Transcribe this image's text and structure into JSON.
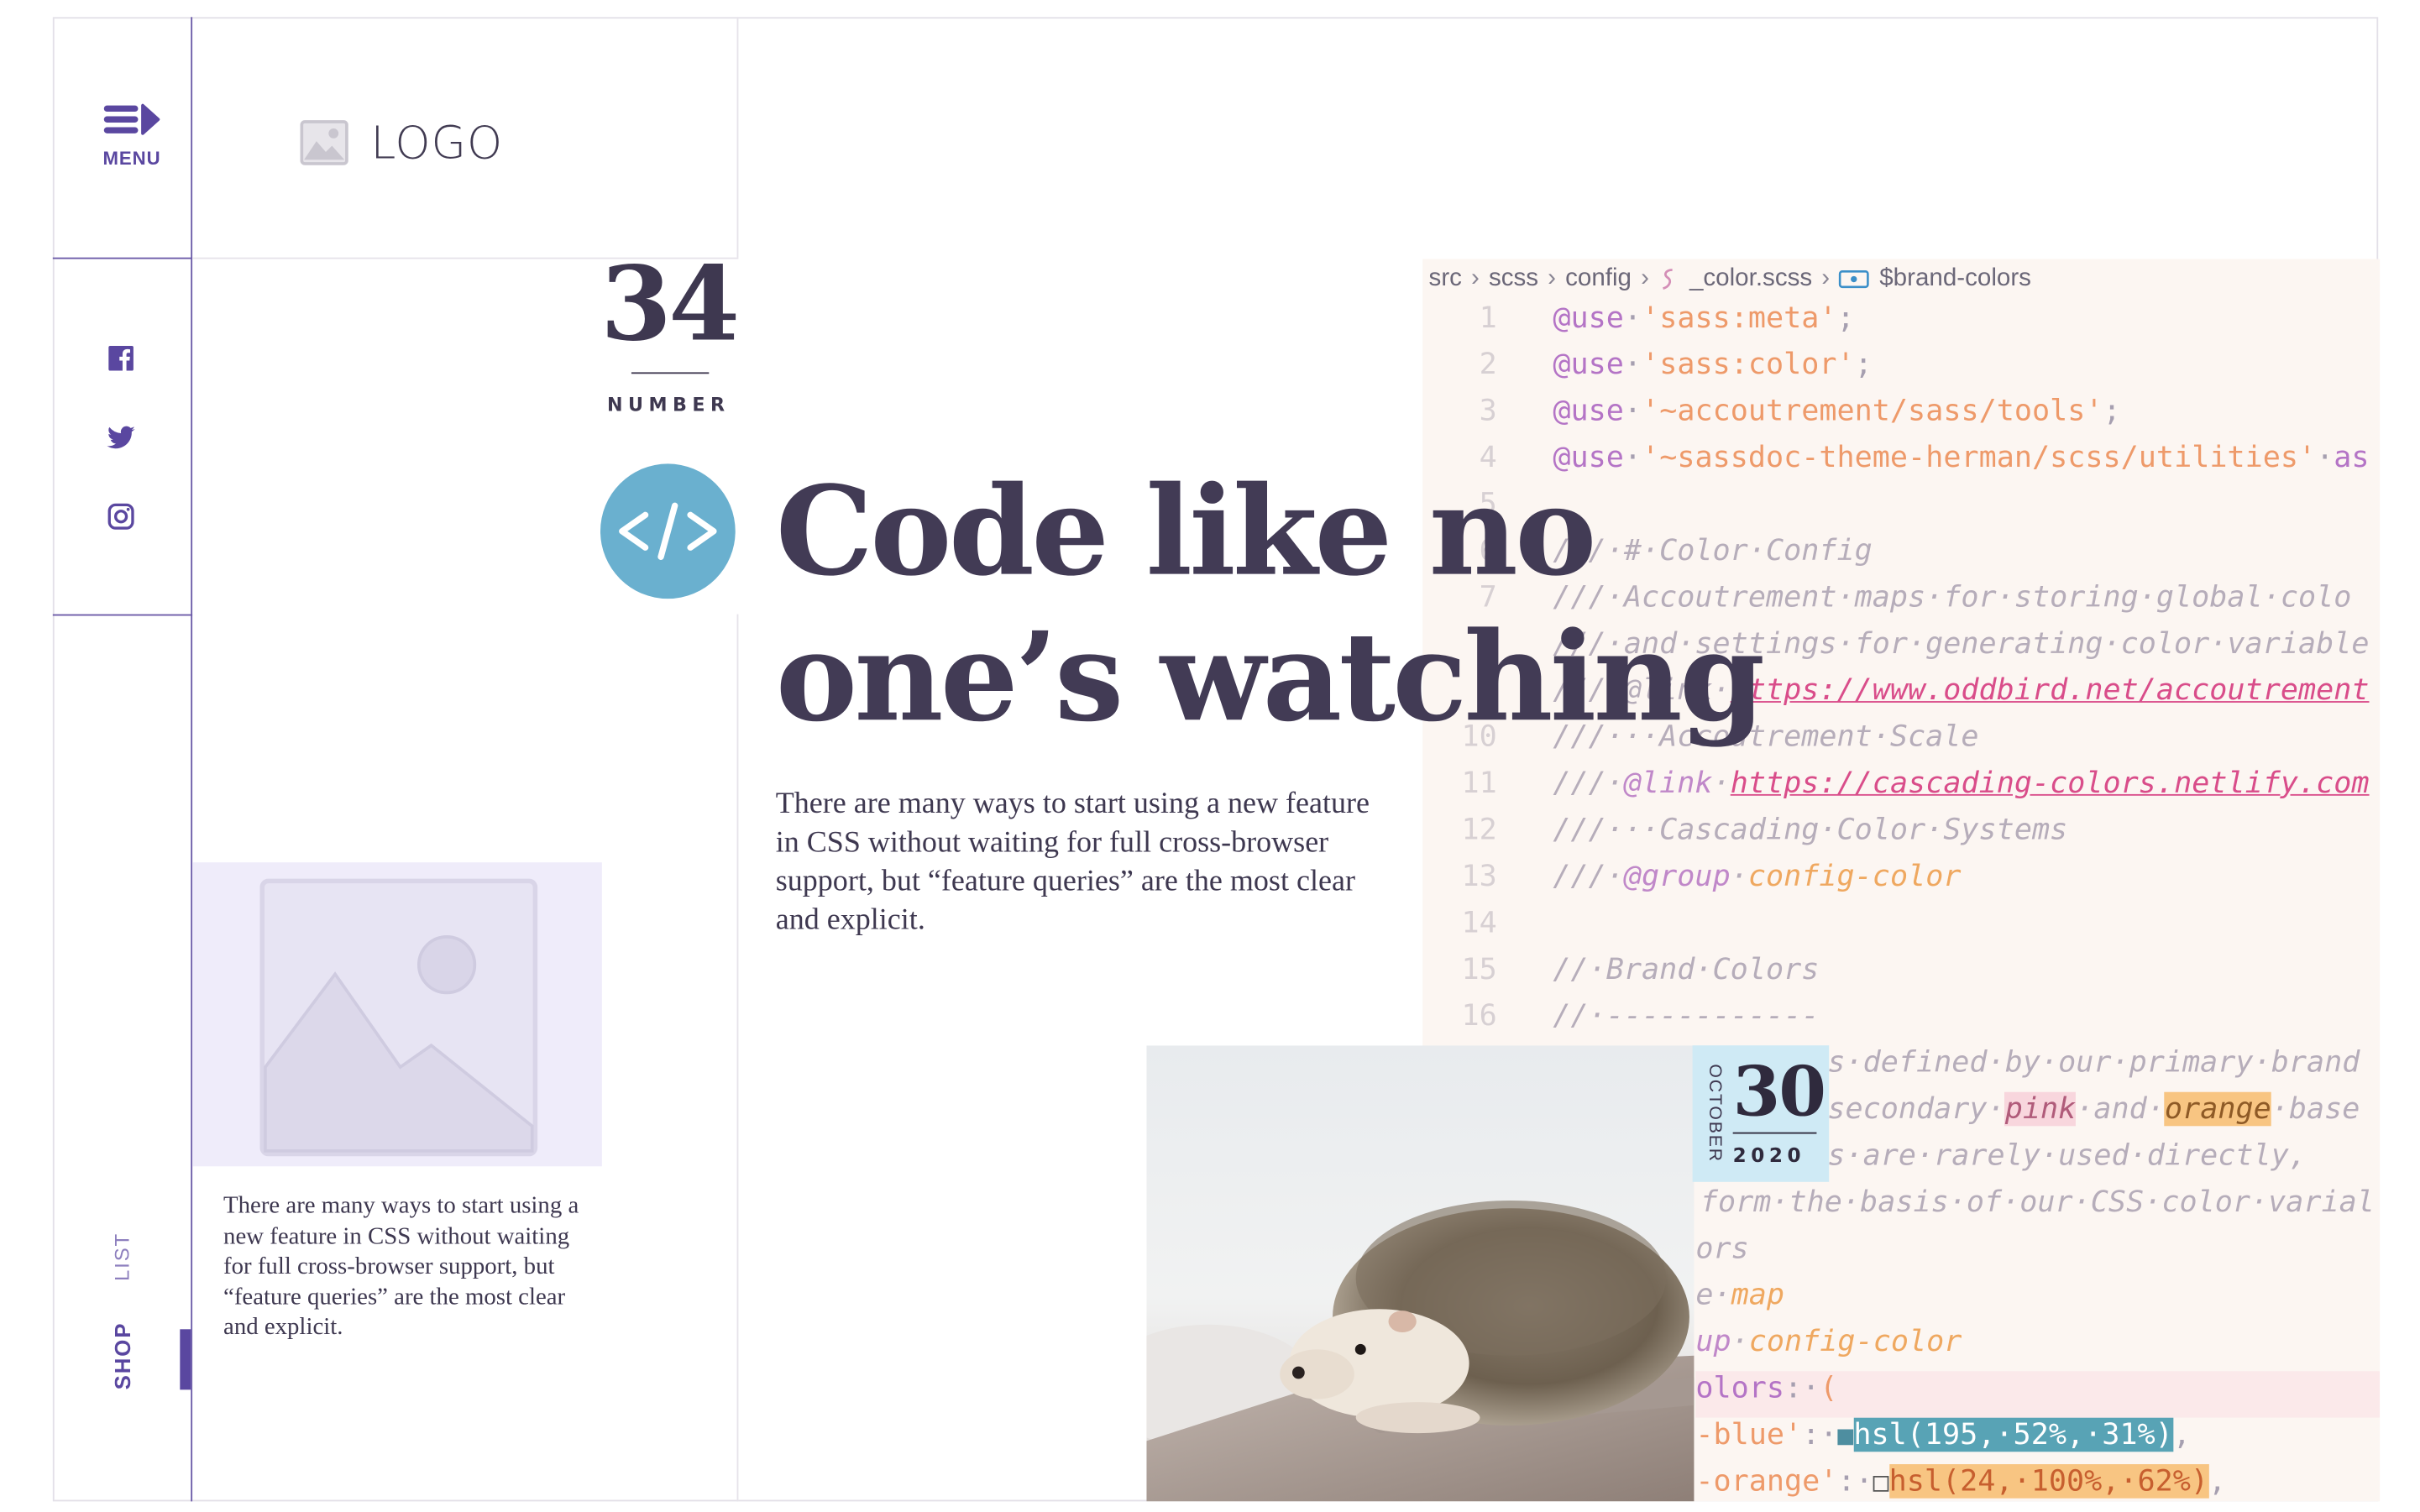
{
  "nav": {
    "menu_label": "MENU",
    "social": [
      "facebook-icon",
      "twitter-icon",
      "instagram-icon"
    ],
    "tabs": {
      "list": "LIST",
      "shop": "SHOP"
    }
  },
  "logo": {
    "text": "LOGO"
  },
  "issue": {
    "number": "34",
    "label": "NUMBER"
  },
  "article": {
    "headline_line1": "Code like no",
    "headline_line2": "one’s watching",
    "intro": "There are many ways to start using a new feature in CSS without waiting for full cross-browser support, but “feature queries” are the most clear and explicit."
  },
  "card": {
    "text": "There are many ways to start using a new feature in CSS without waiting for full cross-browser support, but “feature queries” are the most clear and explicit."
  },
  "editor": {
    "breadcrumbs": [
      "src",
      "scss",
      "config",
      "_color.scss",
      "$brand-colors"
    ],
    "lines": [
      {
        "n": "1",
        "parts": [
          [
            "kw",
            "@use"
          ],
          [
            "",
            "·"
          ],
          [
            "str",
            "'sass:meta'"
          ],
          [
            "",
            ";"
          ]
        ]
      },
      {
        "n": "2",
        "parts": [
          [
            "kw",
            "@use"
          ],
          [
            "",
            "·"
          ],
          [
            "str",
            "'sass:color'"
          ],
          [
            "",
            ";"
          ]
        ]
      },
      {
        "n": "3",
        "parts": [
          [
            "kw",
            "@use"
          ],
          [
            "",
            "·"
          ],
          [
            "str",
            "'~accoutrement/sass/tools'"
          ],
          [
            "",
            ";"
          ]
        ]
      },
      {
        "n": "4",
        "parts": [
          [
            "kw",
            "@use"
          ],
          [
            "",
            "·"
          ],
          [
            "str",
            "'~sassdoc-theme-herman/scss/utilities'"
          ],
          [
            "",
            "·"
          ],
          [
            "kw",
            "as"
          ]
        ]
      },
      {
        "n": "5",
        "parts": []
      },
      {
        "n": "6",
        "parts": [
          [
            "cm",
            "///·#·Color·Config"
          ]
        ]
      },
      {
        "n": "7",
        "parts": [
          [
            "cm",
            "///·Accoutrement·maps·for·storing·global·colo"
          ]
        ]
      },
      {
        "n": "8",
        "parts": [
          [
            "cm",
            "///·and·settings·for·generating·color·variable"
          ]
        ]
      },
      {
        "n": "9",
        "parts": [
          [
            "cm",
            "///·@link·"
          ],
          [
            "lnk",
            "https://www.oddbird.net/accoutrement"
          ]
        ]
      },
      {
        "n": "10",
        "parts": [
          [
            "cm",
            "///···Accoutrement·Scale"
          ]
        ]
      },
      {
        "n": "11",
        "parts": [
          [
            "cm",
            "///·"
          ],
          [
            "tag",
            "@link"
          ],
          [
            "cm",
            "·"
          ],
          [
            "lnk",
            "https://cascading-colors.netlify.com"
          ]
        ]
      },
      {
        "n": "12",
        "parts": [
          [
            "cm",
            "///···Cascading·Color·Systems"
          ]
        ]
      },
      {
        "n": "13",
        "parts": [
          [
            "cm",
            "///·"
          ],
          [
            "tag",
            "@group"
          ],
          [
            "cm",
            "·"
          ],
          [
            "val",
            "config-color"
          ]
        ]
      },
      {
        "n": "14",
        "parts": []
      },
      {
        "n": "15",
        "parts": [
          [
            "cm",
            "//·Brand·Colors"
          ]
        ]
      },
      {
        "n": "16",
        "parts": [
          [
            "cm",
            "//·------------"
          ]
        ]
      }
    ],
    "overflow_lines": [
      {
        "parts": [
          [
            "cm",
            "s·defined·by·our·primary·brand"
          ]
        ]
      },
      {
        "parts": [
          [
            "cm",
            "secondary·"
          ],
          [
            "pink",
            "pink"
          ],
          [
            "cm",
            "·and·"
          ],
          [
            "orange",
            "orange"
          ],
          [
            "cm",
            "·base"
          ]
        ]
      },
      {
        "parts": [
          [
            "cm",
            "s·are·rarely·used·directly,"
          ]
        ]
      },
      {
        "parts": [
          [
            "cm",
            "form·the·basis·of·our·CSS·color·varial"
          ]
        ]
      },
      {
        "parts": [
          [
            "cm",
            "ors"
          ]
        ]
      },
      {
        "parts": [
          [
            "cm",
            "e·"
          ],
          [
            "val",
            "map"
          ]
        ]
      },
      {
        "parts": [
          [
            "tag",
            "up"
          ],
          [
            "cm",
            "·"
          ],
          [
            "val",
            "config-color"
          ]
        ]
      },
      {
        "parts": [
          [
            "kw",
            "olors"
          ],
          [
            "",
            ":·"
          ],
          [
            "str",
            "("
          ]
        ]
      },
      {
        "parts": [
          [
            "str",
            "-blue'"
          ],
          [
            "",
            ":·"
          ],
          [
            "chipblue",
            "■"
          ],
          [
            "hslblue",
            "hsl(195,·52%,·31%)"
          ],
          [
            "",
            ","
          ]
        ]
      },
      {
        "parts": [
          [
            "str",
            "-orange'"
          ],
          [
            "",
            ":·"
          ],
          [
            "chiporange",
            "□"
          ],
          [
            "hslorange",
            "hsl(24,·100%,·62%)"
          ],
          [
            "",
            ","
          ]
        ]
      }
    ]
  },
  "date": {
    "month": "OCTOBER",
    "day": "30",
    "year": "2020"
  },
  "colors": {
    "accent": "#5a47a0",
    "badge": "#6ab0cf",
    "date_badge": "#cfeaf5",
    "editor_bg": "#fcf6f2"
  }
}
